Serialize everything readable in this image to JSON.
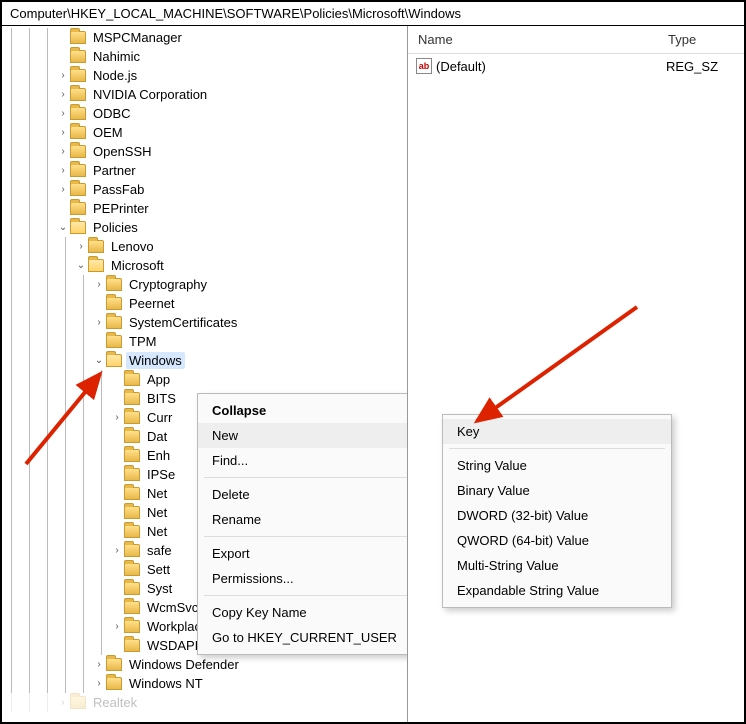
{
  "address": "Computer\\HKEY_LOCAL_MACHINE\\SOFTWARE\\Policies\\Microsoft\\Windows",
  "list": {
    "headers": {
      "name": "Name",
      "type": "Type"
    },
    "rows": [
      {
        "name": "(Default)",
        "type": "REG_SZ"
      }
    ]
  },
  "tree": [
    {
      "depth": 3,
      "exp": "",
      "label": "MSPCManager"
    },
    {
      "depth": 3,
      "exp": "",
      "label": "Nahimic"
    },
    {
      "depth": 3,
      "exp": ">",
      "label": "Node.js"
    },
    {
      "depth": 3,
      "exp": ">",
      "label": "NVIDIA Corporation"
    },
    {
      "depth": 3,
      "exp": ">",
      "label": "ODBC"
    },
    {
      "depth": 3,
      "exp": ">",
      "label": "OEM"
    },
    {
      "depth": 3,
      "exp": ">",
      "label": "OpenSSH"
    },
    {
      "depth": 3,
      "exp": ">",
      "label": "Partner"
    },
    {
      "depth": 3,
      "exp": ">",
      "label": "PassFab"
    },
    {
      "depth": 3,
      "exp": "",
      "label": "PEPrinter"
    },
    {
      "depth": 3,
      "exp": "v",
      "label": "Policies",
      "open": true
    },
    {
      "depth": 4,
      "exp": ">",
      "label": "Lenovo"
    },
    {
      "depth": 4,
      "exp": "v",
      "label": "Microsoft",
      "open": true
    },
    {
      "depth": 5,
      "exp": ">",
      "label": "Cryptography"
    },
    {
      "depth": 5,
      "exp": "",
      "label": "Peernet"
    },
    {
      "depth": 5,
      "exp": ">",
      "label": "SystemCertificates"
    },
    {
      "depth": 5,
      "exp": "",
      "label": "TPM"
    },
    {
      "depth": 5,
      "exp": "v",
      "label": "Windows",
      "open": true,
      "selected": true
    },
    {
      "depth": 6,
      "exp": "",
      "label": "App"
    },
    {
      "depth": 6,
      "exp": "",
      "label": "BITS"
    },
    {
      "depth": 6,
      "exp": ">",
      "label": "Curr"
    },
    {
      "depth": 6,
      "exp": "",
      "label": "Dat"
    },
    {
      "depth": 6,
      "exp": "",
      "label": "Enh"
    },
    {
      "depth": 6,
      "exp": "",
      "label": "IPSe"
    },
    {
      "depth": 6,
      "exp": "",
      "label": "Net"
    },
    {
      "depth": 6,
      "exp": "",
      "label": "Net"
    },
    {
      "depth": 6,
      "exp": "",
      "label": "Net"
    },
    {
      "depth": 6,
      "exp": ">",
      "label": "safe"
    },
    {
      "depth": 6,
      "exp": "",
      "label": "Sett"
    },
    {
      "depth": 6,
      "exp": "",
      "label": "Syst"
    },
    {
      "depth": 6,
      "exp": "",
      "label": "WcmSvc"
    },
    {
      "depth": 6,
      "exp": ">",
      "label": "WorkplaceJoin"
    },
    {
      "depth": 6,
      "exp": "",
      "label": "WSDAPI"
    },
    {
      "depth": 5,
      "exp": ">",
      "label": "Windows Defender"
    },
    {
      "depth": 5,
      "exp": ">",
      "label": "Windows NT"
    },
    {
      "depth": 3,
      "exp": ">",
      "label": "Realtek",
      "cut": true
    }
  ],
  "context_menu": {
    "items": [
      {
        "label": "Collapse",
        "bold": true
      },
      {
        "label": "New",
        "submenu": true,
        "hover": true
      },
      {
        "label": "Find..."
      },
      {
        "sep": true
      },
      {
        "label": "Delete"
      },
      {
        "label": "Rename"
      },
      {
        "sep": true
      },
      {
        "label": "Export"
      },
      {
        "label": "Permissions..."
      },
      {
        "sep": true
      },
      {
        "label": "Copy Key Name"
      },
      {
        "label": "Go to HKEY_CURRENT_USER"
      }
    ]
  },
  "submenu": {
    "items": [
      {
        "label": "Key",
        "hover": true
      },
      {
        "sep": true
      },
      {
        "label": "String Value"
      },
      {
        "label": "Binary Value"
      },
      {
        "label": "DWORD (32-bit) Value"
      },
      {
        "label": "QWORD (64-bit) Value"
      },
      {
        "label": "Multi-String Value"
      },
      {
        "label": "Expandable String Value"
      }
    ]
  }
}
